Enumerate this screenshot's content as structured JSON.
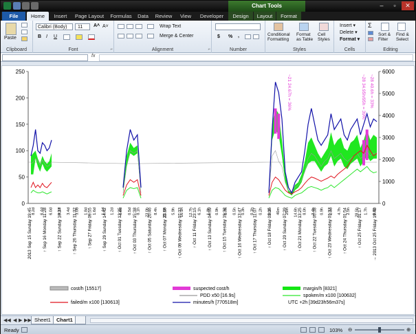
{
  "titlebar": {
    "title": "",
    "chart_tools": "Chart Tools"
  },
  "tabs": [
    "File",
    "Home",
    "Insert",
    "Page Layout",
    "Formulas",
    "Data",
    "Review",
    "View",
    "Developer",
    "Design",
    "Layout",
    "Format"
  ],
  "ribbon": {
    "clipboard": {
      "label": "Clipboard",
      "paste": "Paste"
    },
    "font": {
      "label": "Font",
      "name": "Calibri (Body)",
      "size": "11",
      "bold": "B",
      "italic": "I",
      "underline": "U"
    },
    "alignment": {
      "label": "Alignment",
      "wrap": "Wrap Text",
      "merge": "Merge & Center"
    },
    "number": {
      "label": "Number",
      "currency": "$",
      "percent": "%",
      "comma": ","
    },
    "styles": {
      "label": "Styles",
      "conditional": "Conditional\nFormatting",
      "format_table": "Format\nas Table",
      "cell_styles": "Cell\nStyles"
    },
    "cells": {
      "label": "Cells",
      "insert": "Insert",
      "delete": "Delete",
      "format": "Format"
    },
    "editing": {
      "label": "Editing",
      "sum": "Σ",
      "sort": "Sort &\nFilter",
      "find": "Find &\nSelect"
    }
  },
  "formula_bar": {
    "fx": "fx"
  },
  "sheets": [
    "Sheet1",
    "Chart1"
  ],
  "status": {
    "ready": "Ready",
    "zoom": "103%"
  },
  "colors": {
    "magenta": "#e23ad6",
    "green": "#14e614",
    "red": "#e0141e",
    "blue": "#1010a8",
    "gray": "#999999"
  },
  "chart_data": {
    "type": "line",
    "y_left": {
      "min": 0,
      "max": 250,
      "ticks": [
        "0",
        "50",
        "100",
        "150",
        "200",
        "250"
      ]
    },
    "y_right": {
      "min": 0,
      "max": 6000,
      "ticks": [
        "0",
        "1000",
        "2000",
        "3000",
        "4000",
        "5000",
        "6000"
      ]
    },
    "x_tick_labels": [
      "2013 Sep 15 Sunday 19:45",
      "↑ Sep 16 Monday 11:28",
      "↑ Sep 22 Sunday 10:37",
      "↑ Sep 26 Thursday 11:32",
      "↑ Sep 27 Friday 09:55",
      "↑ Sep 29 Sunday 14:42",
      "↑ Oct 01 Tuesday 12:25",
      "↑ Oct 03 Thursday 15:38",
      "↑ Oct 05 Saturday 20:46",
      "↑ Oct 07 Monday 22:18",
      "↑ Oct 09 Wednesday 07:33",
      "↑ Oct 11 Friday 23:15",
      "↑ Oct 13 Sunday 04:59",
      "↑ Oct 15 Tuesday 19:38",
      "↑ Oct 16 Wednesday 13:47",
      "↑ Oct 17 Thursday 11:07",
      "↑ Oct 18 Friday 03:05",
      "↑ Oct 20 Sunday 07:39",
      "↑ Oct 21 Monday 13:25",
      "↑ Oct 22 Tuesday 05:38",
      "↑ Oct 23 Wednesday 01:37",
      "↑ Oct 24 Thursday 01:54",
      "↑ Oct 25 Friday 01:17",
      "→ 2013 Oct 25 Friday 19:42"
    ],
    "x_sub_labels": [
      "8.2d",
      "6.4d",
      "6.0d",
      "4.1d",
      "3.4d",
      "3.0d",
      "1.8d",
      "1.6d",
      "1.4d",
      "1.2d",
      "0.9d",
      "0.5d",
      "8.1h",
      "23.0h",
      "8.4h",
      "21.6h",
      "5.9h",
      "16.1h",
      "12.7h",
      "6.1h",
      "1.3h",
      "0.9h",
      "0.7h",
      "0.5h",
      "0.3h",
      "0.1h",
      "0.2h",
      "0.1h",
      "40m",
      "25m",
      "14.6h",
      "8.0h",
      "3.4h",
      "0.9h",
      "2.3d",
      "4.7h",
      "2.5h",
      "28.5h",
      "1.7h",
      "0.5h"
    ],
    "annotations": [
      "~21 24.67h = 36%",
      "~28 34.95h/95h = 39%",
      "~28 40.6h = 33%"
    ],
    "series": [
      {
        "name": "cost/h [15517]",
        "axis": "left"
      },
      {
        "name": "suspected cost/h",
        "axis": "left"
      },
      {
        "name": "margin/h [8321]",
        "axis": "left"
      },
      {
        "name": "PDD x50 [16.9s]",
        "axis": "left"
      },
      {
        "name": "spoken/m x100 [100632]",
        "axis": "left"
      },
      {
        "name": "failed/m x100 [130613]",
        "axis": "left"
      },
      {
        "name": "minutes/h [770518m]",
        "axis": "left"
      },
      {
        "name": "UTC +2h [39d23h56m37s]",
        "axis": "right"
      }
    ],
    "segments": [
      {
        "n": 10,
        "minutes": [
          90,
          110,
          140,
          100,
          95,
          115,
          110,
          100,
          105,
          120
        ],
        "margin_lo": [
          55,
          55,
          85,
          70,
          60,
          75,
          65,
          60,
          65,
          70
        ],
        "margin_hi": [
          90,
          95,
          100,
          85,
          75,
          90,
          80,
          75,
          80,
          95
        ],
        "cost": [
          75,
          78,
          85,
          80,
          72,
          82,
          75,
          70,
          72,
          78
        ],
        "failed": [
          30,
          40,
          30,
          35,
          30,
          38,
          32,
          30,
          35,
          40
        ],
        "spoken": [
          20,
          25,
          22,
          20,
          20,
          22,
          20,
          18,
          20,
          22
        ]
      },
      {
        "n": 6,
        "minutes": [
          30,
          100,
          140,
          120,
          130,
          30
        ],
        "margin_lo": [
          20,
          70,
          95,
          90,
          95,
          20
        ],
        "margin_hi": [
          25,
          90,
          115,
          105,
          110,
          25
        ],
        "cost": [
          20,
          70,
          100,
          95,
          100,
          20
        ],
        "failed": [
          15,
          35,
          45,
          40,
          45,
          15
        ],
        "spoken": [
          10,
          25,
          30,
          28,
          30,
          10
        ]
      },
      {
        "n": 34,
        "minutes": [
          20,
          140,
          230,
          210,
          160,
          60,
          30,
          20,
          40,
          50,
          60,
          100,
          150,
          180,
          150,
          120,
          110,
          120,
          130,
          170,
          140,
          150,
          160,
          130,
          120,
          140,
          150,
          160,
          130,
          150,
          170,
          145,
          160,
          155
        ],
        "margin_lo": [
          10,
          120,
          140,
          130,
          90,
          40,
          20,
          15,
          25,
          30,
          40,
          60,
          75,
          80,
          80,
          70,
          60,
          70,
          75,
          90,
          70,
          80,
          85,
          70,
          65,
          75,
          80,
          85,
          70,
          80,
          90,
          80,
          85,
          85
        ],
        "margin_hi": [
          15,
          150,
          180,
          170,
          120,
          60,
          25,
          20,
          35,
          40,
          55,
          80,
          115,
          125,
          110,
          95,
          85,
          95,
          105,
          135,
          110,
          120,
          125,
          105,
          100,
          115,
          120,
          130,
          105,
          120,
          140,
          120,
          130,
          125
        ],
        "cost": [
          20,
          90,
          100,
          80,
          70,
          40,
          25,
          20,
          30,
          35,
          45,
          60,
          85,
          95,
          90,
          80,
          70,
          80,
          85,
          100,
          85,
          90,
          95,
          85,
          80,
          85,
          90,
          95,
          85,
          90,
          100,
          90,
          95,
          95
        ],
        "failed": [
          15,
          40,
          50,
          45,
          35,
          25,
          20,
          18,
          22,
          25,
          30,
          38,
          45,
          50,
          48,
          45,
          42,
          45,
          48,
          52,
          48,
          55,
          60,
          65,
          70,
          80,
          90,
          95,
          100,
          95,
          110,
          100,
          90,
          95
        ],
        "spoken": [
          10,
          25,
          30,
          28,
          22,
          15,
          12,
          10,
          15,
          18,
          20,
          25,
          30,
          32,
          30,
          28,
          25,
          28,
          30,
          35,
          30,
          35,
          40,
          45,
          50,
          55,
          60,
          65,
          60,
          65,
          70,
          62,
          58,
          60
        ],
        "suspected_idx": [
          2,
          3,
          29,
          30
        ]
      }
    ],
    "legend_placement": "bottom",
    "grid": false
  }
}
